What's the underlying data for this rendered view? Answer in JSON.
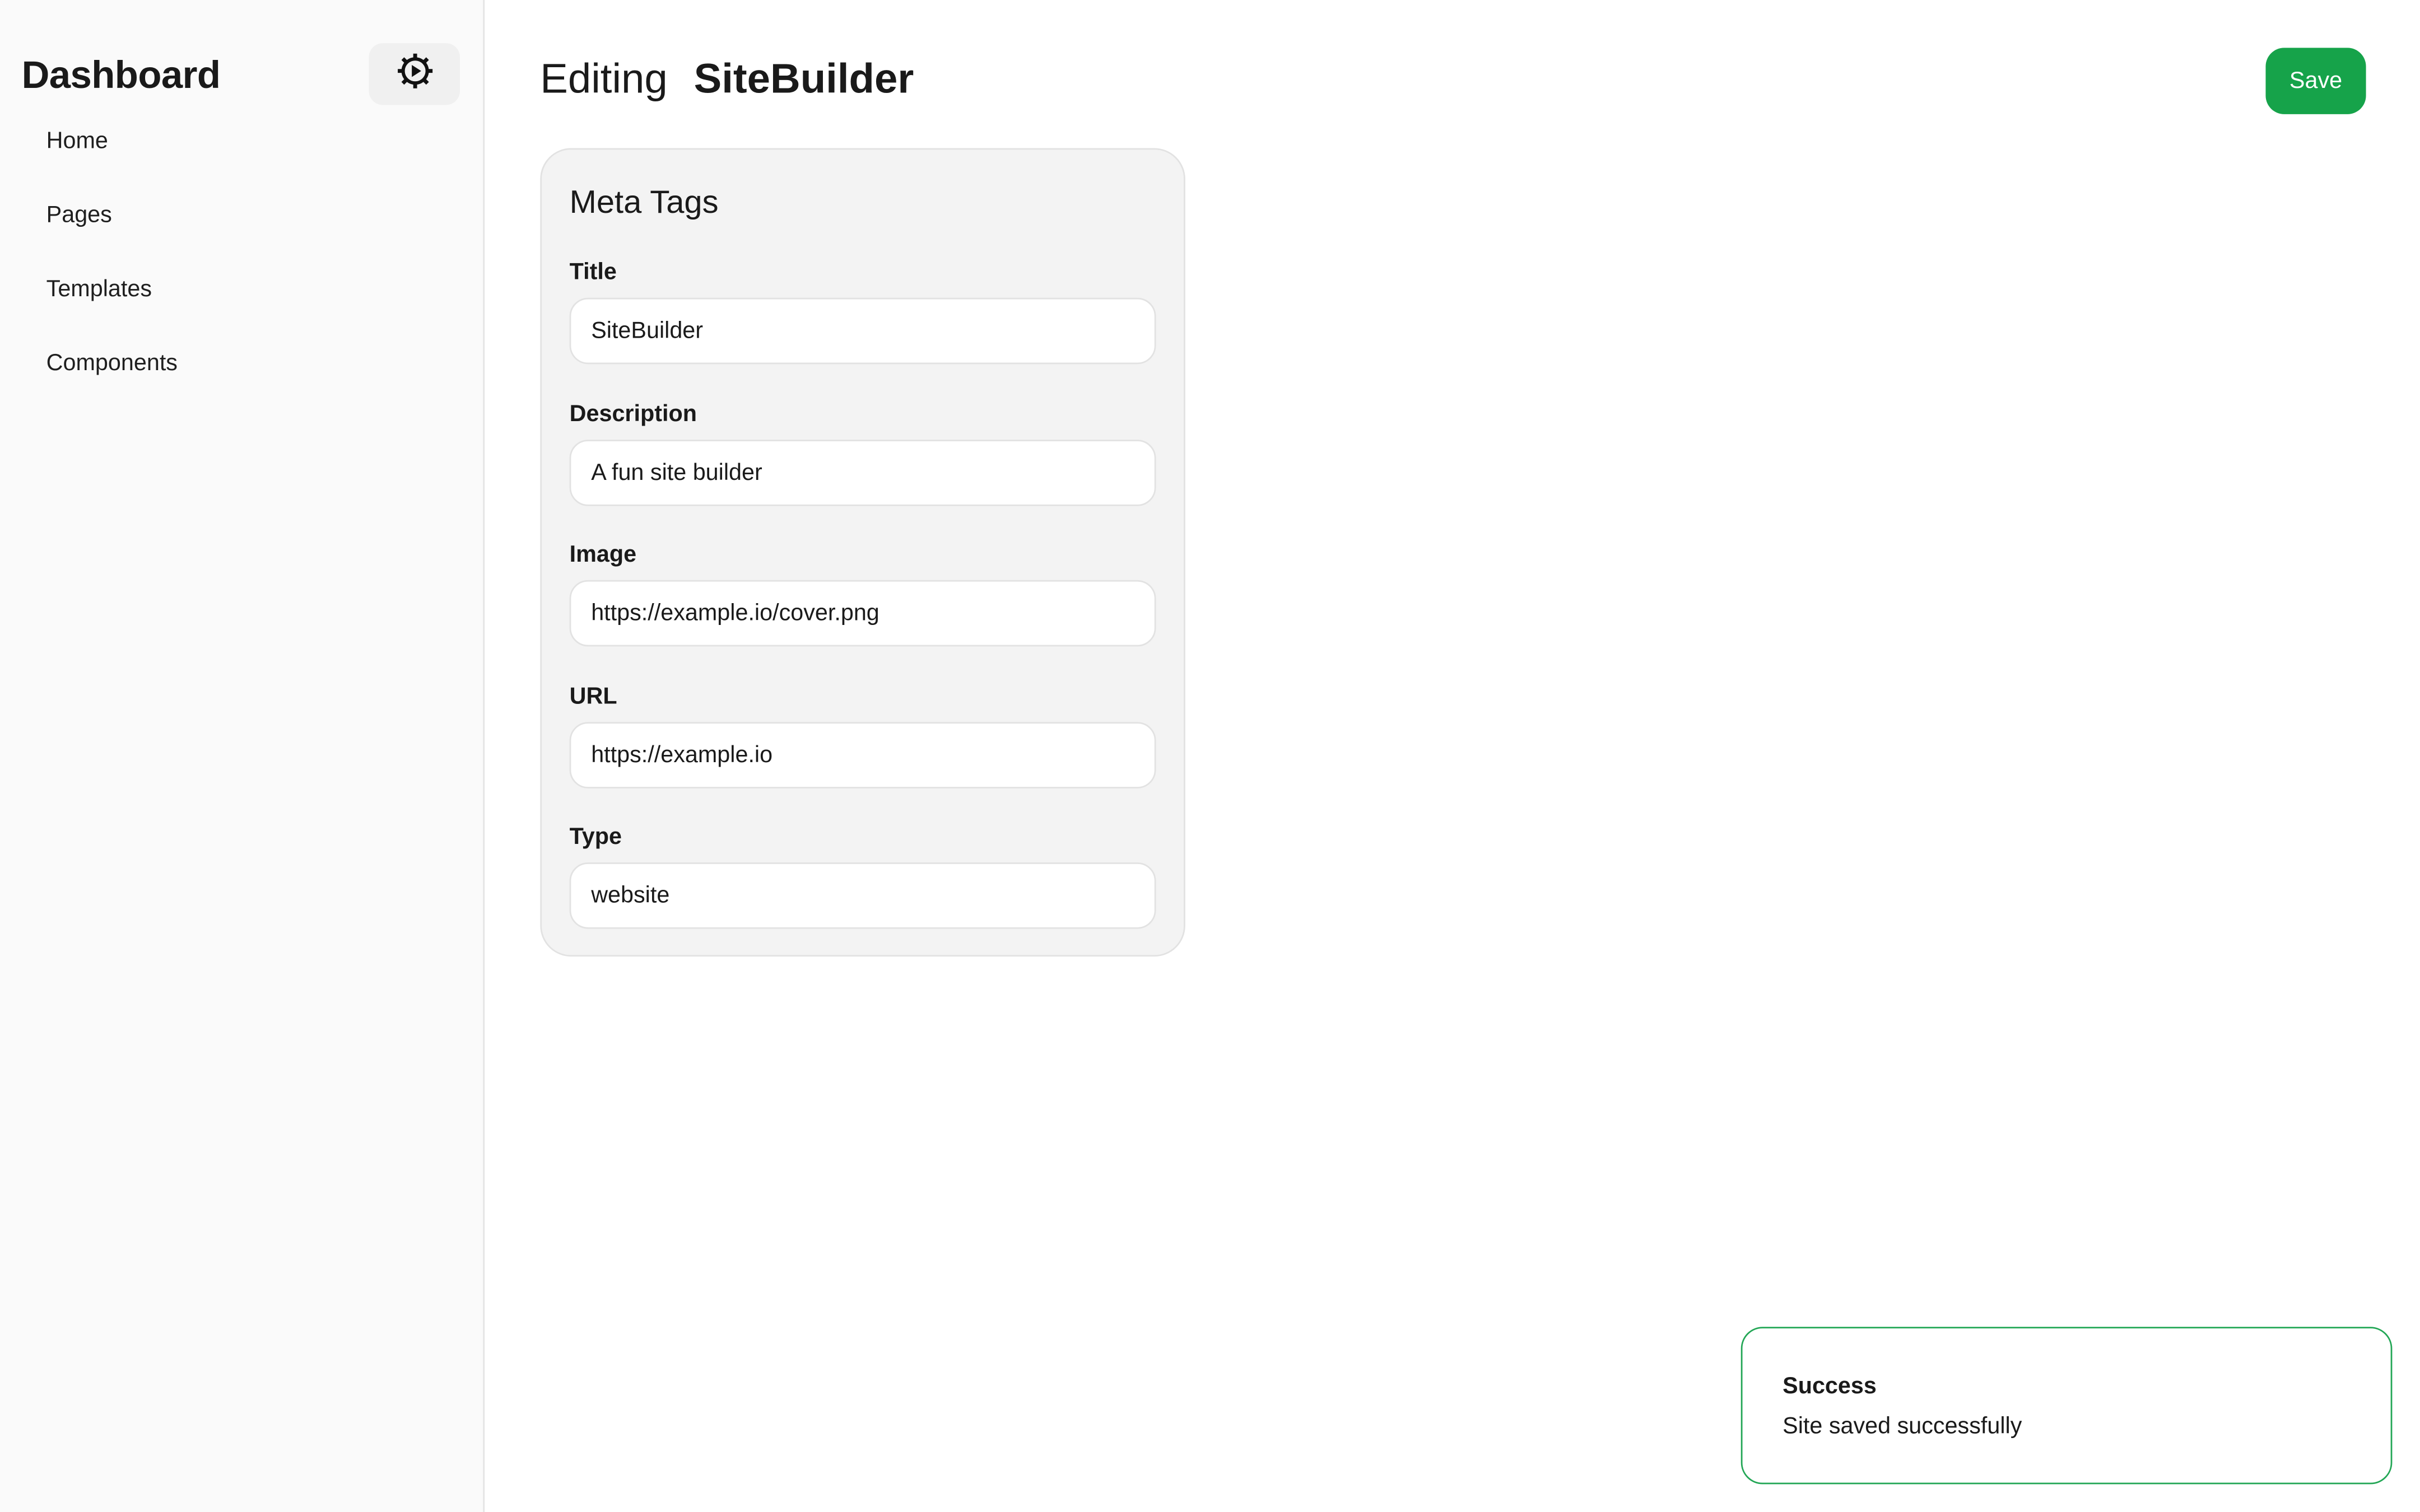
{
  "sidebar": {
    "title": "Dashboard",
    "settings_icon": "gear-icon",
    "items": [
      {
        "label": "Home"
      },
      {
        "label": "Pages"
      },
      {
        "label": "Templates"
      },
      {
        "label": "Components"
      }
    ]
  },
  "header": {
    "prefix": "Editing",
    "site_name": "SiteBuilder",
    "save_label": "Save"
  },
  "meta_tags": {
    "title": "Meta Tags",
    "fields": [
      {
        "label": "Title",
        "value": "SiteBuilder"
      },
      {
        "label": "Description",
        "value": "A fun site builder"
      },
      {
        "label": "Image",
        "value": "https://example.io/cover.png"
      },
      {
        "label": "URL",
        "value": "https://example.io"
      },
      {
        "label": "Type",
        "value": "website"
      }
    ]
  },
  "toast": {
    "title": "Success",
    "message": "Site saved successfully"
  },
  "colors": {
    "accent": "#16a34a",
    "toast_border": "#22a655",
    "sidebar_bg": "#fafafa",
    "card_bg": "#f3f3f3"
  }
}
